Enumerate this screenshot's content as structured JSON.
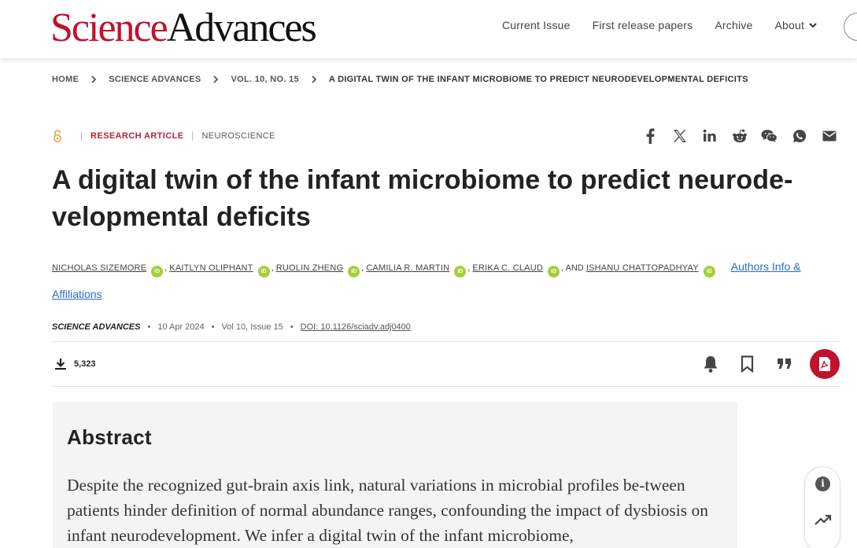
{
  "header": {
    "logo": {
      "part1": "Science",
      "part2": "Advances"
    },
    "nav": [
      "Current Issue",
      "First release papers",
      "Archive"
    ],
    "about_label": "About"
  },
  "breadcrumb": [
    "HOME",
    "SCIENCE ADVANCES",
    "VOL. 10, NO. 15",
    "A DIGITAL TWIN OF THE INFANT MICROBIOME TO PREDICT NEURODEVELOPMENTAL DEFICITS"
  ],
  "article": {
    "type": "RESEARCH ARTICLE",
    "subject": "NEUROSCIENCE",
    "title": "A digital twin of the infant microbiome to predict neurode-velopmental deficits",
    "authors": [
      "NICHOLAS SIZEMORE",
      "KAITLYN OLIPHANT",
      "RUOLIN ZHENG",
      "CAMILIA R. MARTIN",
      "ERIKA C. CLAUD",
      "ISHANU CHATTOPADHYAY"
    ],
    "and_label": "AND",
    "orcid_label": "iD",
    "affiliations_link": "Authors Info & Affiliations",
    "journal": "SCIENCE ADVANCES",
    "date": "10 Apr 2024",
    "volume": "Vol 10, Issue 15",
    "doi": "DOI: 10.1126/sciadv.adj0400",
    "downloads": "5,323"
  },
  "share_icons": [
    "facebook-icon",
    "x-icon",
    "linkedin-icon",
    "reddit-icon",
    "wechat-icon",
    "whatsapp-icon",
    "email-icon"
  ],
  "abstract": {
    "heading": "Abstract",
    "text": "Despite the recognized gut-brain axis link, natural variations in microbial profiles be-tween patients hinder definition of normal abundance ranges, confounding the impact of dysbiosis on infant neurodevelopment. We infer a digital twin of the infant microbiome,"
  },
  "side_widget": {
    "info_glyph": "i"
  },
  "colors": {
    "brand_red": "#c0122d",
    "link_blue": "#2a6cc8",
    "orcid_green": "#a6ce39"
  }
}
